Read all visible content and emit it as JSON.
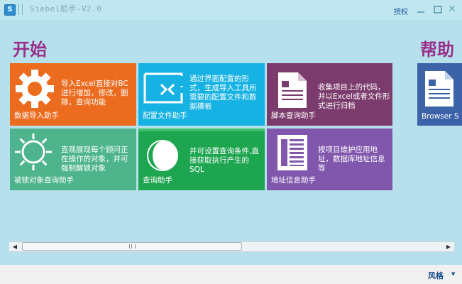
{
  "window": {
    "title": "Siebel助手-V2.0",
    "app_icon": "S",
    "auth_label": "授权",
    "minimize_icon": "minimize-icon",
    "maximize_icon": "maximize-icon",
    "close_glyph": "✕"
  },
  "sections": {
    "start_title": "开始",
    "help_title": "帮助"
  },
  "tiles": [
    {
      "name": "数据导入助手",
      "desc": "导入Excel直接对BC进行增加，修改，删除，查询功能",
      "color": "#ec6c1f",
      "icon": "gear-icon"
    },
    {
      "name": "配置文件助手",
      "desc": "通过界面配置的形式，生成导入工具所需要的配置文件和数据模板",
      "color": "#16b2e3",
      "icon": "screen-arrows-icon"
    },
    {
      "name": "脚本查询助手",
      "desc": "收集项目上的代码，并以Excel或者文件形式进行归档",
      "color": "#7b3b6c",
      "icon": "document-icon"
    },
    {
      "name": "被锁对象查询助手",
      "desc": "直观展现每个顾问正在操作的对象，并可强制解锁对象",
      "color": "#4db48c",
      "icon": "sun-icon"
    },
    {
      "name": "查询助手",
      "desc": "并可设置查询条件,直接获取执行产生的SQL",
      "color": "#1ea550",
      "icon": "moon-icon"
    },
    {
      "name": "地址信息助手",
      "desc": "按项目维护应用地址，数据库地址信息等",
      "color": "#8057ad",
      "icon": "newspaper-icon"
    },
    {
      "name": "Browser S",
      "desc": "",
      "color": "#3c62a8",
      "icon": "word-doc-icon"
    }
  ],
  "scrollbar": {
    "left_arrow": "◀",
    "right_arrow": "▶"
  },
  "footer": {
    "style_label": "风格",
    "dropdown_arrow": "▼"
  }
}
